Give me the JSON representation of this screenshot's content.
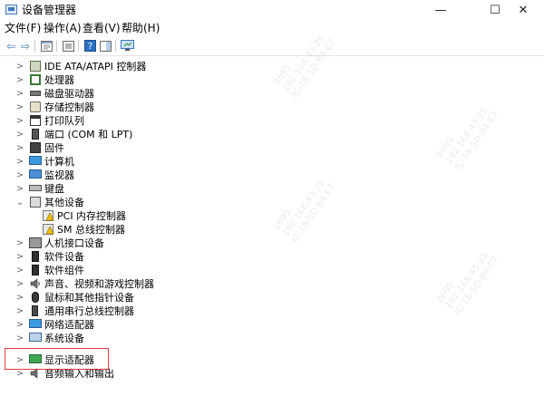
{
  "window": {
    "title": "设备管理器",
    "minimize": "—",
    "maximize": "☐",
    "close": "✕"
  },
  "menu": [
    "文件(F)",
    "操作(A)",
    "查看(V)",
    "帮助(H)"
  ],
  "toolbar": [
    "back-arrow-icon",
    "forward-arrow-icon",
    "properties-pane-icon",
    "view-icon",
    "help-icon",
    "action-pane-icon",
    "monitor-scan-icon"
  ],
  "tree": [
    {
      "label": "IDE ATA/ATAPI 控制器",
      "icon": "ide-controller-icon",
      "expanded": false,
      "level": 0
    },
    {
      "label": "处理器",
      "icon": "processor-icon",
      "expanded": false,
      "level": 0
    },
    {
      "label": "磁盘驱动器",
      "icon": "disk-drive-icon",
      "expanded": false,
      "level": 0
    },
    {
      "label": "存储控制器",
      "icon": "storage-controller-icon",
      "expanded": false,
      "level": 0
    },
    {
      "label": "打印队列",
      "icon": "printer-icon",
      "expanded": false,
      "level": 0
    },
    {
      "label": "端口 (COM 和 LPT)",
      "icon": "port-icon",
      "expanded": false,
      "level": 0
    },
    {
      "label": "固件",
      "icon": "firmware-icon",
      "expanded": false,
      "level": 0
    },
    {
      "label": "计算机",
      "icon": "computer-icon",
      "expanded": false,
      "level": 0
    },
    {
      "label": "监视器",
      "icon": "monitor-icon",
      "expanded": false,
      "level": 0
    },
    {
      "label": "键盘",
      "icon": "keyboard-icon",
      "expanded": false,
      "level": 0
    },
    {
      "label": "其他设备",
      "icon": "other-devices-icon",
      "expanded": true,
      "level": 0
    },
    {
      "label": "PCI 内存控制器",
      "icon": "warning-device-icon",
      "expanded": null,
      "level": 1
    },
    {
      "label": "SM 总线控制器",
      "icon": "warning-device-icon",
      "expanded": null,
      "level": 1
    },
    {
      "label": "人机接口设备",
      "icon": "hid-icon",
      "expanded": false,
      "level": 0
    },
    {
      "label": "软件设备",
      "icon": "software-device-icon",
      "expanded": false,
      "level": 0
    },
    {
      "label": "软件组件",
      "icon": "software-component-icon",
      "expanded": false,
      "level": 0
    },
    {
      "label": "声音、视频和游戏控制器",
      "icon": "speaker-icon",
      "expanded": false,
      "level": 0
    },
    {
      "label": "鼠标和其他指针设备",
      "icon": "mouse-icon",
      "expanded": false,
      "level": 0
    },
    {
      "label": "通用串行总线控制器",
      "icon": "usb-icon",
      "expanded": false,
      "level": 0
    },
    {
      "label": "网络适配器",
      "icon": "network-adapter-icon",
      "expanded": false,
      "level": 0
    },
    {
      "label": "系统设备",
      "icon": "system-device-icon",
      "expanded": false,
      "level": 0
    },
    {
      "label": "显示适配器",
      "icon": "display-adapter-icon",
      "expanded": false,
      "level": 0,
      "highlighted": true
    },
    {
      "label": "音频输入和输出",
      "icon": "audio-io-icon",
      "expanded": false,
      "level": 0
    }
  ],
  "watermark_text": "0695\n192.168.43.25\nIC-18-5D-84-E7",
  "colors": {
    "highlight": "#e0393e",
    "accent": "#3c78c3"
  }
}
